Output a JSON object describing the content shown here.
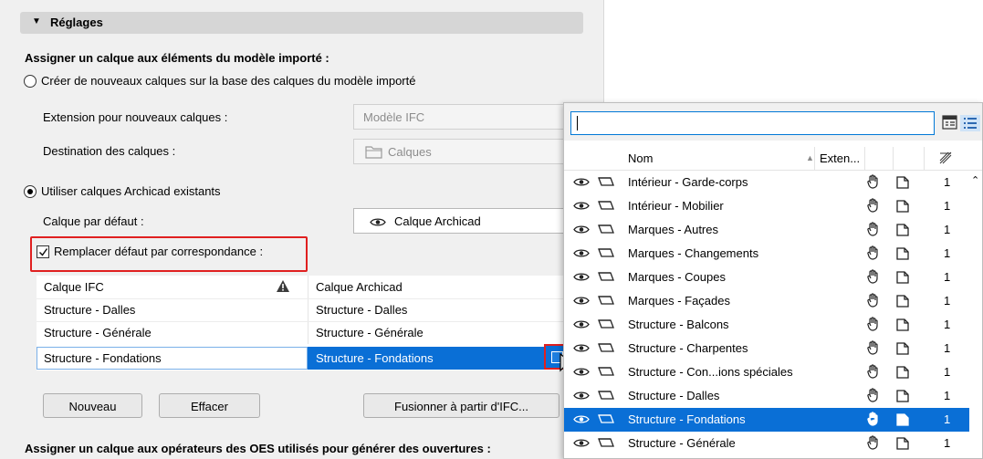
{
  "settings": {
    "header_title": "Réglages",
    "assign_title": "Assigner un calque aux éléments du modèle importé :",
    "radio_create": "Créer de nouveaux calques sur la base des calques du modèle importé",
    "extension_label": "Extension pour nouveaux calques :",
    "extension_value": "Modèle IFC",
    "destination_label": "Destination des calques :",
    "destination_value": "Calques",
    "radio_use_existing": "Utiliser calques Archicad existants",
    "default_layer_label": "Calque par défaut :",
    "default_layer_value": "Calque Archicad",
    "replace_checkbox": "Remplacer défaut par correspondance :",
    "mapping": {
      "col_ifc": "Calque IFC",
      "col_archicad": "Calque Archicad",
      "rows": [
        {
          "ifc": "Structure - Dalles",
          "archicad": "Structure - Dalles"
        },
        {
          "ifc": "Structure - Générale",
          "archicad": "Structure - Générale"
        },
        {
          "ifc": "Structure - Fondations",
          "archicad": "Structure - Fondations"
        }
      ]
    },
    "btn_new": "Nouveau",
    "btn_delete": "Effacer",
    "btn_merge": "Fusionner à partir d'IFC...",
    "assign_oes_title": "Assigner un calque aux opérateurs des OES utilisés pour générer des ouvertures :"
  },
  "layer_popup": {
    "search_value": "",
    "col_name": "Nom",
    "col_extension": "Exten...",
    "selected_index": 10,
    "layers": [
      {
        "name": "Intérieur - Garde-corps",
        "num": "1"
      },
      {
        "name": "Intérieur - Mobilier",
        "num": "1"
      },
      {
        "name": "Marques - Autres",
        "num": "1"
      },
      {
        "name": "Marques - Changements",
        "num": "1"
      },
      {
        "name": "Marques - Coupes",
        "num": "1"
      },
      {
        "name": "Marques - Façades",
        "num": "1"
      },
      {
        "name": "Structure - Balcons",
        "num": "1"
      },
      {
        "name": "Structure - Charpentes",
        "num": "1"
      },
      {
        "name": "Structure - Con...ions spéciales",
        "num": "1"
      },
      {
        "name": "Structure - Dalles",
        "num": "1"
      },
      {
        "name": "Structure - Fondations",
        "num": "1"
      },
      {
        "name": "Structure - Générale",
        "num": "1"
      }
    ]
  },
  "colors": {
    "selection": "#0a6fd6",
    "highlight_red": "#e02020",
    "panel_bg": "#f0f0f0"
  }
}
